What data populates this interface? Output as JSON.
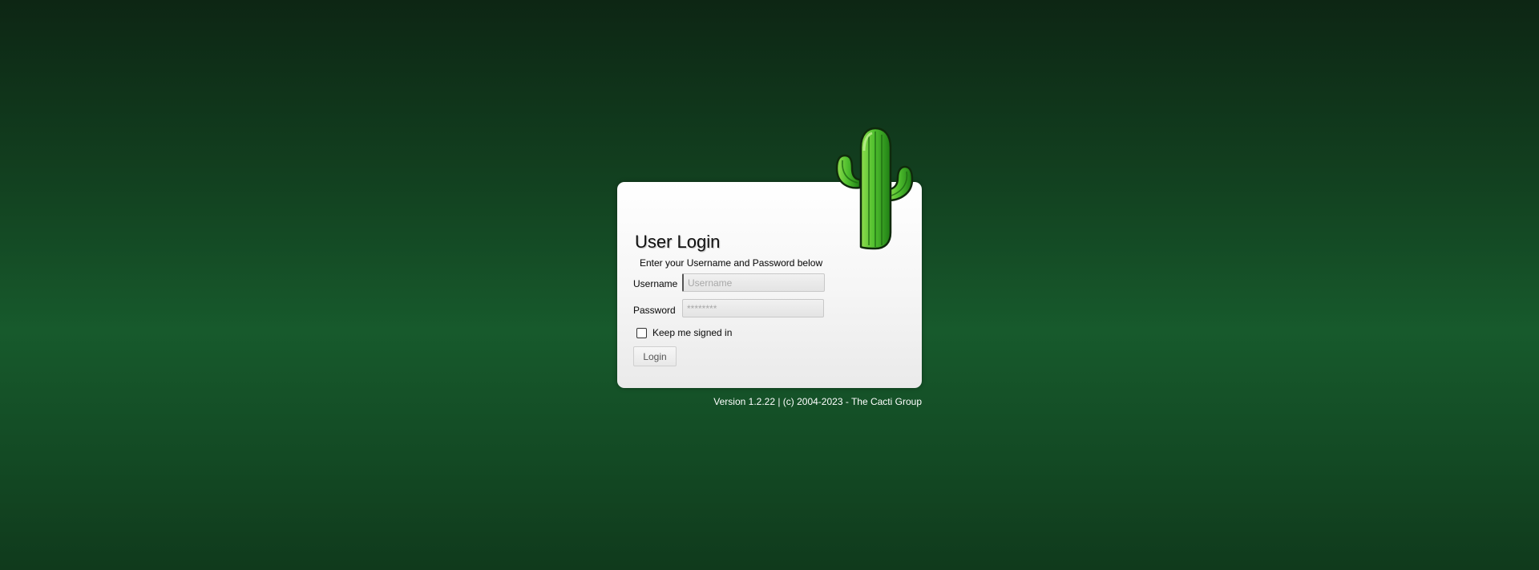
{
  "login": {
    "title": "User Login",
    "subtitle": "Enter your Username and Password below",
    "username_label": "Username",
    "username_placeholder": "Username",
    "username_value": "",
    "password_label": "Password",
    "password_placeholder": "********",
    "password_value": "",
    "remember_label": "Keep me signed in",
    "remember_checked": false,
    "login_button": "Login"
  },
  "footer": {
    "version": "Version 1.2.22 | (c) 2004-2023 - The Cacti Group"
  },
  "icons": {
    "logo": "cactus-logo-icon"
  },
  "colors": {
    "background_top": "#0d2614",
    "background_mid": "#175a2c",
    "cactus_green": "#3fae2a"
  }
}
